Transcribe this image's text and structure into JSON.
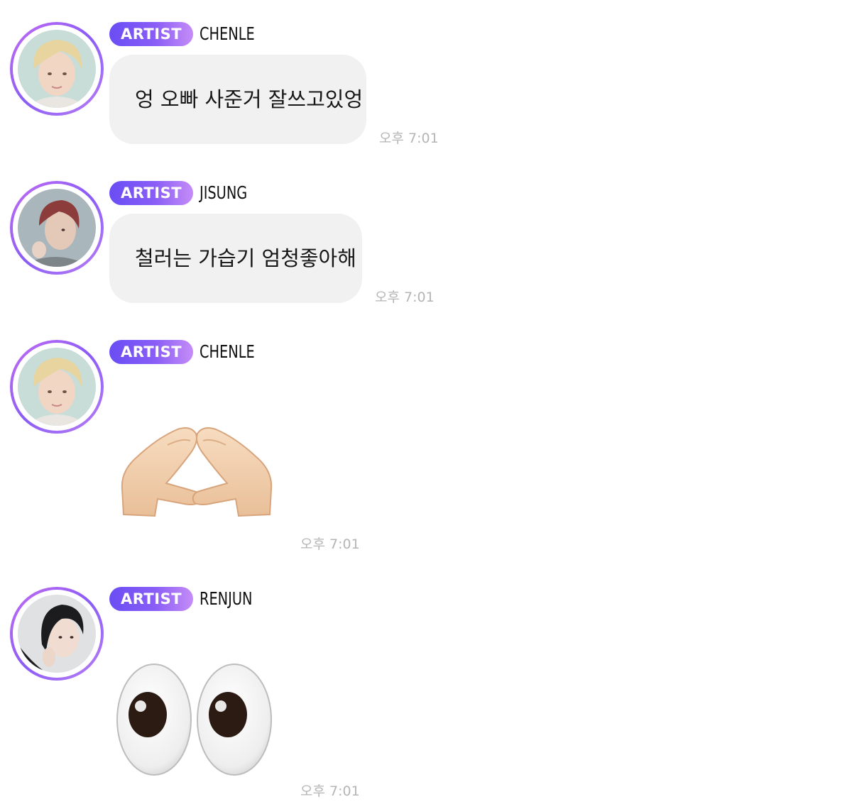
{
  "badge_label": "ARTIST",
  "messages": [
    {
      "sender": "CHENLE",
      "text": "엉 오빠 사준거 잘쓰고있엉",
      "time": "오후 7:01",
      "avatar_icon": "chenle-avatar"
    },
    {
      "sender": "JISUNG",
      "text": "철러는 가습기 엄청좋아해",
      "time": "오후 7:01",
      "avatar_icon": "jisung-avatar"
    },
    {
      "sender": "CHENLE",
      "emoji": "heart-hands-emoji",
      "time": "오후 7:01",
      "avatar_icon": "chenle-avatar"
    },
    {
      "sender": "RENJUN",
      "emoji": "eyes-emoji",
      "time": "오후 7:01",
      "avatar_icon": "renjun-avatar"
    }
  ],
  "colors": {
    "badge_start": "#6a4df4",
    "badge_end": "#c58cf7",
    "ring": "#a262f5",
    "bubble": "#f1f1f1",
    "timestamp": "#b5b5b5"
  }
}
